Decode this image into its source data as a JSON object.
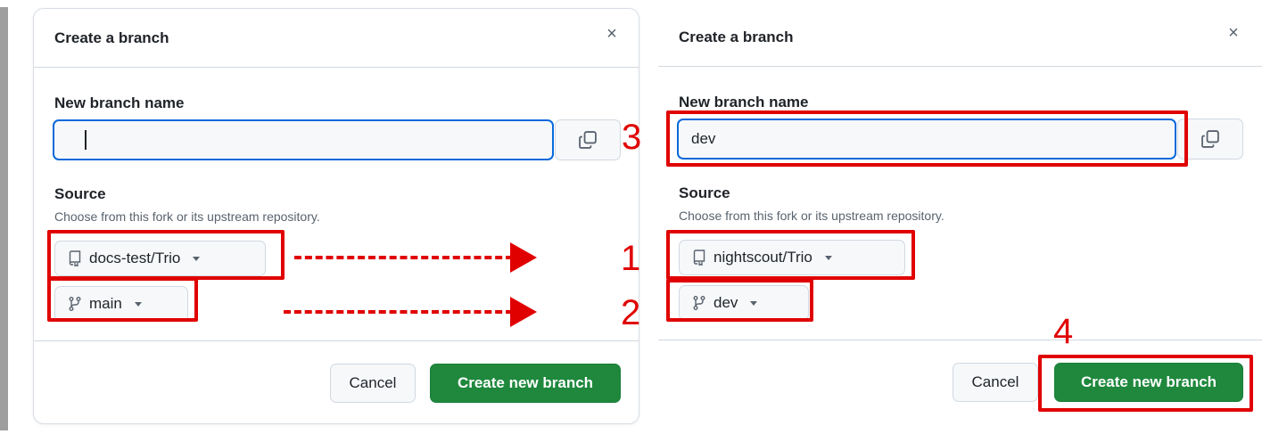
{
  "before": {
    "title": "Create a branch",
    "close_symbol": "×",
    "name_label": "New branch name",
    "name_value": "",
    "source_label": "Source",
    "source_help": "Choose from this fork or its upstream repository.",
    "repo_select": "docs-test/Trio",
    "branch_select": "main",
    "cancel_label": "Cancel",
    "create_label": "Create new branch"
  },
  "after": {
    "title": "Create a branch",
    "close_symbol": "×",
    "name_label": "New branch name",
    "name_value": "dev",
    "source_label": "Source",
    "source_help": "Choose from this fork or its upstream repository.",
    "repo_select": "nightscout/Trio",
    "branch_select": "dev",
    "cancel_label": "Cancel",
    "create_label": "Create new branch"
  },
  "annotations": {
    "step_repo": "1",
    "step_branch": "2",
    "step_name": "3",
    "step_create": "4",
    "color": "#e00000"
  },
  "icons": {
    "close": "close-icon",
    "copy": "copy-icon",
    "repo": "repo-icon",
    "branch": "git-branch-icon",
    "dropdown": "chevron-down-icon"
  },
  "colors": {
    "primary_button": "#1f883d",
    "focus_border": "#0969da"
  }
}
